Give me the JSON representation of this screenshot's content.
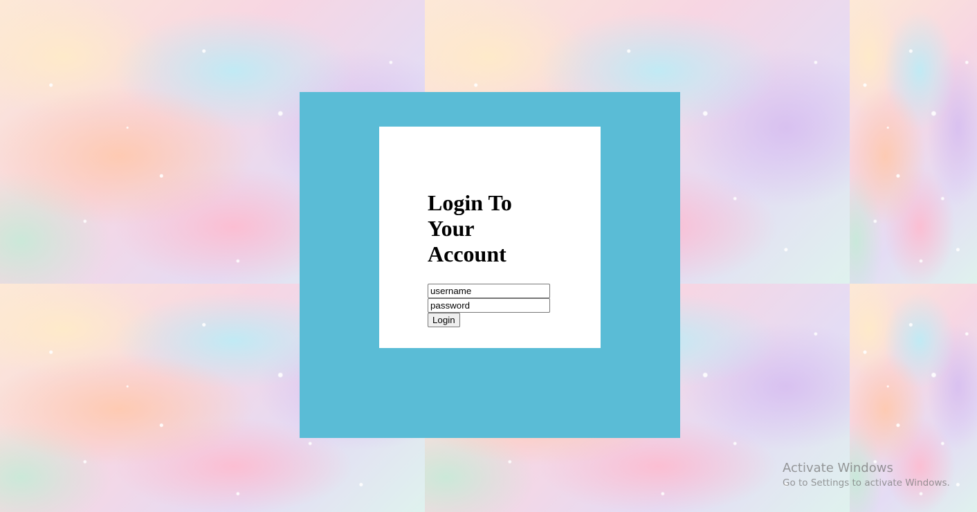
{
  "login": {
    "title": "Login To Your Account",
    "username_placeholder": "username",
    "password_placeholder": "password",
    "submit_label": "Login"
  },
  "watermark": {
    "title": "Activate Windows",
    "subtitle": "Go to Settings to activate Windows."
  },
  "colors": {
    "panel": "#5abcd6",
    "card": "#ffffff"
  }
}
